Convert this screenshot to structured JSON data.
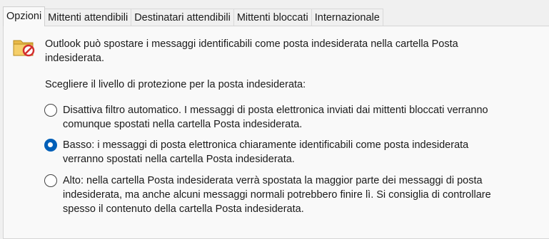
{
  "tabs": [
    {
      "label": "Opzioni",
      "active": true
    },
    {
      "label": "Mittenti attendibili",
      "active": false
    },
    {
      "label": "Destinatari attendibili",
      "active": false
    },
    {
      "label": "Mittenti bloccati",
      "active": false
    },
    {
      "label": "Internazionale",
      "active": false
    }
  ],
  "options": {
    "icon": "junk-folder-icon",
    "intro_line1": "Outlook può spostare i messaggi identificabili come posta indesiderata nella cartella Posta",
    "intro_line2": "indesiderata.",
    "prompt": "Scegliere il livello di protezione per la posta indesiderata:",
    "levels": [
      {
        "line1": "Disattiva filtro automatico. I messaggi di posta elettronica inviati dai mittenti bloccati verranno",
        "line2": "comunque spostati nella cartella Posta indesiderata.",
        "selected": false
      },
      {
        "line1": "Basso: i messaggi di posta elettronica chiaramente identificabili come posta indesiderata",
        "line2": "verranno spostati nella cartella Posta indesiderata.",
        "selected": true
      },
      {
        "line1": "Alto: nella cartella Posta indesiderata verrà spostata la maggior parte dei messaggi di posta",
        "line2": "indesiderata, ma anche alcuni messaggi normali potrebbero finire lì. Si consiglia di controllare",
        "line3": "spesso il contenuto della cartella Posta indesiderata.",
        "selected": false
      }
    ]
  },
  "colors": {
    "accent": "#005fb8",
    "background": "#f0f0f0",
    "panel": "#f9f9f9"
  }
}
